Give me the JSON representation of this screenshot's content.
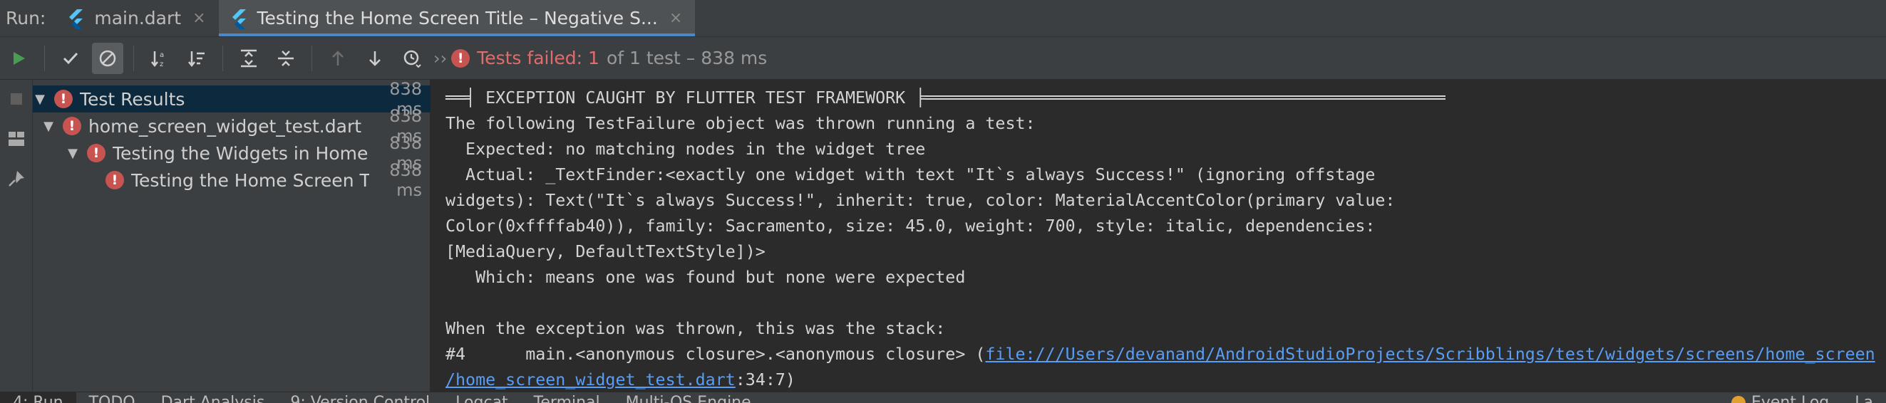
{
  "run_bar": {
    "label": "Run:",
    "tabs": [
      {
        "label": "main.dart",
        "close": "×"
      },
      {
        "label": "Testing the Home Screen Title – Negative S...",
        "close": "×"
      }
    ]
  },
  "toolbar": {
    "overflow": "››",
    "status_failed": "Tests failed: 1",
    "status_rest": "of 1 test – 838 ms"
  },
  "tree": {
    "items": [
      {
        "name": "Test Results",
        "time": "838 ms"
      },
      {
        "name": "home_screen_widget_test.dart",
        "time": "838 ms"
      },
      {
        "name": "Testing the Widgets in Home Screen",
        "time": "838 ms"
      },
      {
        "name": "Testing the Home Screen Title – Negative Scenario",
        "time": "838 ms"
      }
    ]
  },
  "console": {
    "lines": [
      "══╡ EXCEPTION CAUGHT BY FLUTTER TEST FRAMEWORK ╞════════════════════════════════════════════════════",
      "The following TestFailure object was thrown running a test:",
      "  Expected: no matching nodes in the widget tree",
      "  Actual: _TextFinder:<exactly one widget with text \"It`s always Success!\" (ignoring offstage",
      "widgets): Text(\"It`s always Success!\", inherit: true, color: MaterialAccentColor(primary value:",
      "Color(0xffffab40)), family: Sacramento, size: 45.0, weight: 700, style: italic, dependencies:",
      "[MediaQuery, DefaultTextStyle])>",
      "   Which: means one was found but none were expected",
      "",
      "When the exception was thrown, this was the stack:"
    ],
    "stack_prefix": "#4      main.<anonymous closure>.<anonymous closure> (",
    "stack_link": "file:///Users/devanand/AndroidStudioProjects/Scribblings/test/widgets/screens/home_screen",
    "stack_link_cont": "/home_screen_widget_test.dart",
    "stack_suffix": ":34:7)"
  },
  "bottom_bar": {
    "items": [
      "4: Run",
      "TODO",
      "Dart Analysis",
      "9: Version Control",
      "Logcat",
      "Terminal",
      "Multi-OS Engine"
    ],
    "right_items": [
      "Event Log",
      "La"
    ]
  },
  "colors": {
    "error": "#c75450",
    "link": "#589df6",
    "selection": "#0d293e",
    "run_green": "#499c54"
  }
}
